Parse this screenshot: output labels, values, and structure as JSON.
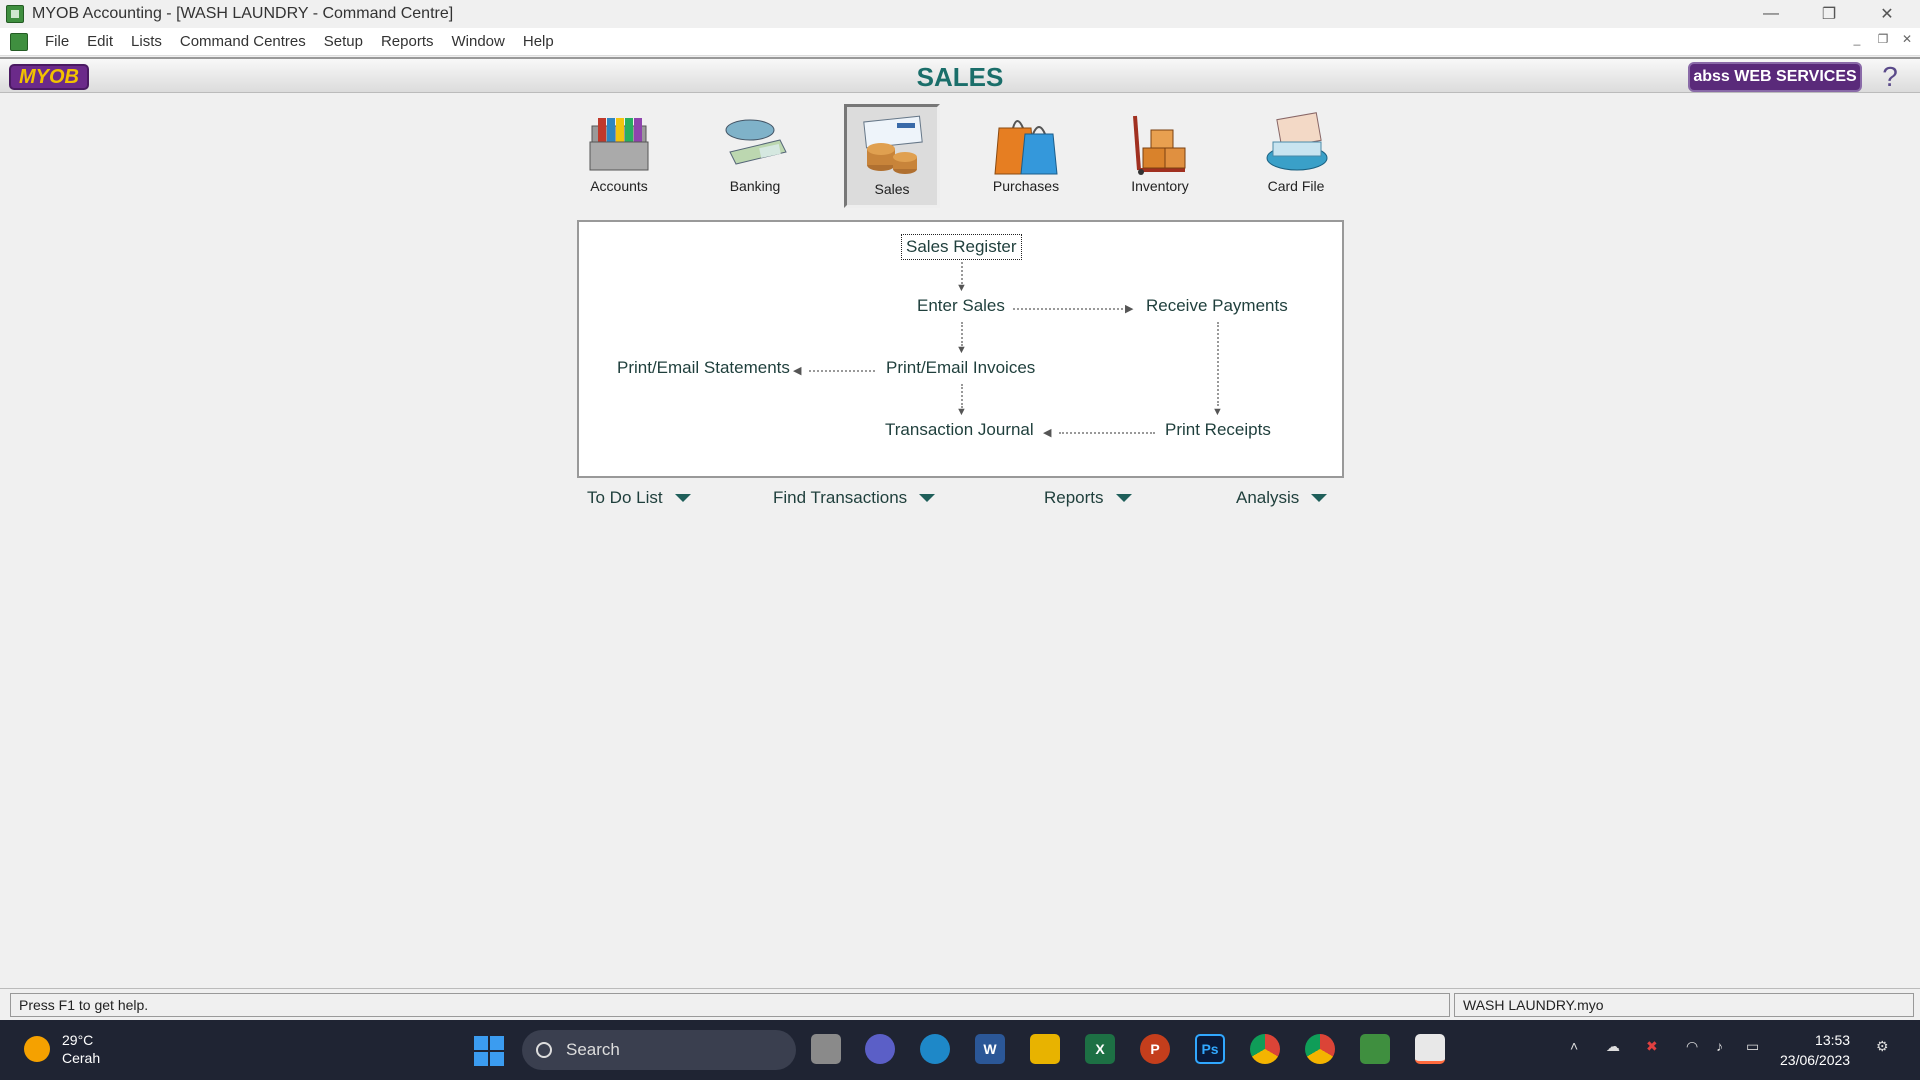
{
  "window": {
    "title": "MYOB Accounting - [WASH LAUNDRY - Command Centre]",
    "minimize_glyph": "—",
    "restore_glyph": "❐",
    "close_glyph": "✕"
  },
  "menu": {
    "items": [
      "File",
      "Edit",
      "Lists",
      "Command Centres",
      "Setup",
      "Reports",
      "Window",
      "Help"
    ]
  },
  "header": {
    "logo": "MYOB",
    "title": "SALES",
    "web_services": "abss WEB SERVICES",
    "help_glyph": "?"
  },
  "modules": [
    {
      "label": "Accounts",
      "icon": "folders-icon"
    },
    {
      "label": "Banking",
      "icon": "banking-icon"
    },
    {
      "label": "Sales",
      "icon": "invoice-coins-icon",
      "active": true
    },
    {
      "label": "Purchases",
      "icon": "shopping-bag-icon"
    },
    {
      "label": "Inventory",
      "icon": "boxes-trolley-icon"
    },
    {
      "label": "Card File",
      "icon": "rolodex-icon"
    }
  ],
  "flow": {
    "sales_register": "Sales Register",
    "enter_sales": "Enter Sales",
    "receive_payments": "Receive Payments",
    "print_email_statements": "Print/Email Statements",
    "print_email_invoices": "Print/Email Invoices",
    "transaction_journal": "Transaction Journal",
    "print_receipts": "Print Receipts"
  },
  "dropdowns": {
    "todo": "To Do List",
    "find": "Find Transactions",
    "reports": "Reports",
    "analysis": "Analysis"
  },
  "status": {
    "hint": "Press F1 to get help.",
    "file": "WASH LAUNDRY.myo"
  },
  "taskbar": {
    "temp": "29°C",
    "weather": "Cerah",
    "search_placeholder": "Search",
    "time": "13:53",
    "date": "23/06/2023",
    "apps": [
      "task-view-icon",
      "teams-icon",
      "edge-icon",
      "word-icon",
      "file-explorer-icon",
      "excel-icon",
      "powerpoint-icon",
      "photoshop-icon",
      "chrome-icon",
      "chrome-profile-icon",
      "myob-icon",
      "snipping-tool-icon"
    ],
    "word_letter": "W",
    "excel_letter": "X",
    "ppt_letter": "P",
    "ps_letter": "Ps"
  }
}
